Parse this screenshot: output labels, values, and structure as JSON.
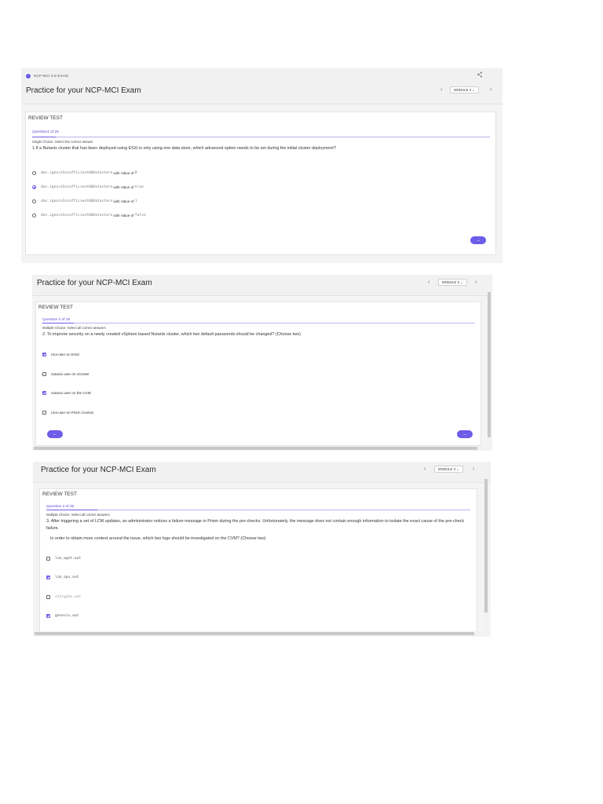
{
  "exam_tag": "NCP-MCI 6.5 EXAM",
  "icons": {
    "share": "share-icon",
    "prev": "chevron-left-icon",
    "next": "chevron-right-icon",
    "dropdown": "chevron-down-icon",
    "logo": "logo-icon",
    "next_btn": "arrow-right-icon",
    "prev_btn": "arrow-left-icon"
  },
  "colors": {
    "accent": "#6c5ce7"
  },
  "panels": [
    {
      "title": "Practice for your NCP-MCI Exam",
      "module": "MODULE 3",
      "review": "REVIEW TEST",
      "count": "Question1 of 25",
      "type": "Single Choice: Select the correct answer",
      "question": "1.If a Nutanix cluster that has been deployed using ESXi is only using one data store, which advanced option needs to be set during the initial cluster deployment?",
      "options": [
        {
          "code": "das.ignoreInsufficientHbDatastore",
          "mid": " with Value of ",
          "value": "0",
          "selected": false
        },
        {
          "code": "das.ignoreInsufficientHbDatastore",
          "mid": " with Value of ",
          "value": "true",
          "selected": true
        },
        {
          "code": "das.ignoreInsufficientHbDatastore",
          "mid": " with Value of ",
          "value": "1",
          "selected": false
        },
        {
          "code": "das.ignoreInsufficientHbDatastore",
          "mid": " with Value of ",
          "value": "false",
          "selected": false
        }
      ],
      "next_arrow": "→"
    },
    {
      "title": "Practice for your NCP-MCI Exam",
      "module": "MODULE 3",
      "review": "REVIEW TEST",
      "count": "Question 2 of 25",
      "type": "Multiple Choice: Select all correct answers",
      "question": "2. To improve security on a newly created vSphere based Nutanix cluster, which two default passwords should be changed? (Choose two)",
      "options": [
        {
          "label": "root user on ESXi",
          "checked": true
        },
        {
          "label": "nutanix user on vCenter",
          "checked": false
        },
        {
          "label": "nutanix user on the CVM",
          "checked": true
        },
        {
          "label": "root user on Prism Central",
          "checked": false
        }
      ],
      "prev_arrow": "←",
      "next_arrow": "→"
    },
    {
      "title": "Practice for your NCP-MCI Exam",
      "module": "MODULE 3",
      "review": "REVIEW TEST",
      "count": "Question 3 of 25",
      "type": "Multiple Choice: Select all correct answers",
      "question": "3. After triggering a set of LCM updates, an administrator notices a failure message in Prism during the pre-checks. Unfortunately, the message does not contain enough information to isolate the exact cause of the pre-check failure.",
      "question_extra": "In order to obtain more context around the issue, which two logs should be investigated on the CVM? (Choose two)",
      "options": [
        {
          "label": "lcm_wget.out",
          "checked": false
        },
        {
          "label": "lcm_ops.out",
          "checked": true
        },
        {
          "label": "stargate.out",
          "checked": false
        },
        {
          "label": "genesis.out",
          "checked": true
        }
      ]
    }
  ]
}
